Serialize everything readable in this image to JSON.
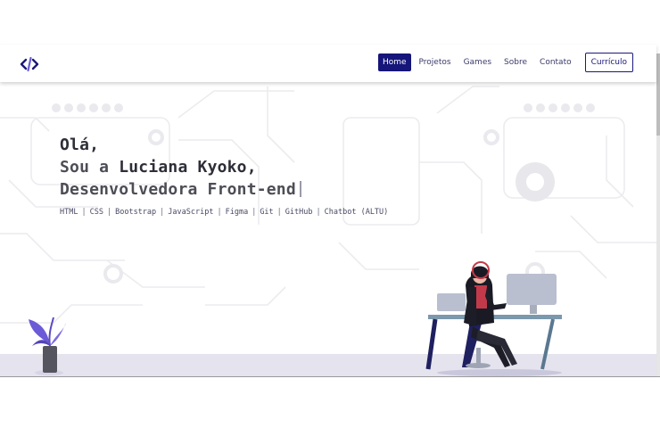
{
  "header": {
    "logo_icon": "code-brackets-icon",
    "nav": [
      {
        "label": "Home",
        "active": true
      },
      {
        "label": "Projetos",
        "active": false
      },
      {
        "label": "Games",
        "active": false
      },
      {
        "label": "Sobre",
        "active": false
      },
      {
        "label": "Contato",
        "active": false
      }
    ],
    "cv_label": "Currículo"
  },
  "hero": {
    "line1": "Olá,",
    "line2_prefix": "Sou a ",
    "line2_name": "Luciana Kyoko,",
    "line3": "Desenvolvedora Front-end",
    "skills": [
      "HTML",
      "CSS",
      "Bootstrap",
      "JavaScript",
      "Figma",
      "Git",
      "GitHub",
      "Chatbot (ALTU)"
    ]
  },
  "colors": {
    "accent": "#15157a",
    "floor": "#e4e3ee",
    "plant_leaf": "#6b5bd6"
  }
}
